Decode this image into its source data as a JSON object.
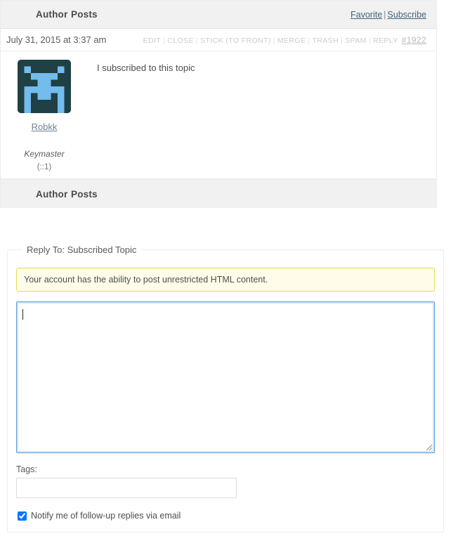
{
  "table_header": {
    "author_label": "Author",
    "posts_label": "Posts",
    "favorite_label": "Favorite",
    "separator": "|",
    "subscribe_label": "Subscribe"
  },
  "post": {
    "date": "July 31, 2015 at 3:37 am",
    "admin_links": [
      "EDIT",
      "CLOSE",
      "STICK (TO FRONT)",
      "MERGE",
      "TRASH",
      "SPAM",
      "REPLY"
    ],
    "admin_separator": "|",
    "permalink": "#1922",
    "author": {
      "name": "Robkk",
      "role": "Keymaster",
      "ip": "(::1)",
      "avatar_icon": "identicon-avatar",
      "avatar_bg": "#1f4044",
      "avatar_fg": "#73bcec"
    },
    "content": "I subscribed to this topic"
  },
  "table_footer": {
    "author_label": "Author",
    "posts_label": "Posts"
  },
  "reply_form": {
    "legend": "Reply To: Subscribed Topic",
    "html_notice": "Your account has the ability to post unrestricted HTML content.",
    "textarea_value": "",
    "textarea_placeholder": "",
    "tags_label": "Tags:",
    "tags_value": "",
    "tags_placeholder": "",
    "notify_label": "Notify me of follow-up replies via email",
    "notify_checked": true
  },
  "colors": {
    "header_bg": "#f1f1f1",
    "notice_bg": "#fffde9",
    "notice_border": "#e6db55",
    "focus_border": "#5b9dd9",
    "link": "#41637a"
  }
}
